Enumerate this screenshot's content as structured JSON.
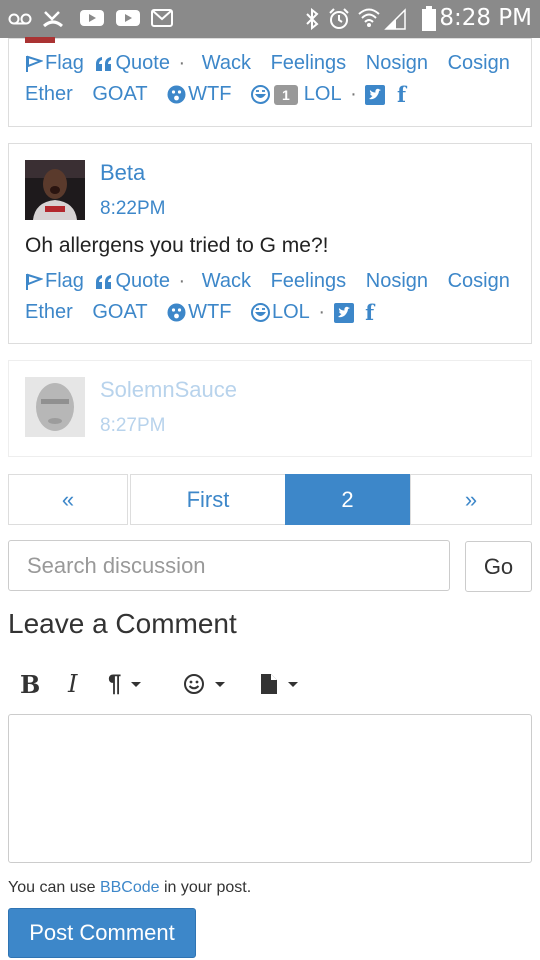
{
  "status_bar": {
    "time": "8:28 PM",
    "icons": [
      "voicemail-icon",
      "missed-call-icon",
      "youtube-icon",
      "youtube-icon",
      "gmail-icon",
      "bluetooth-icon",
      "alarm-icon",
      "wifi-icon",
      "signal-icon",
      "battery-icon"
    ]
  },
  "reactions": {
    "flag": "Flag",
    "quote": "Quote",
    "wack": "Wack",
    "feelings": "Feelings",
    "nosign": "Nosign",
    "cosign": "Cosign",
    "ether": "Ether",
    "goat": "GOAT",
    "wtf": "WTF",
    "lol": "LOL",
    "separator": "·",
    "facebook": "f"
  },
  "comments": [
    {
      "lol_count": "1"
    },
    {
      "author": "Beta",
      "time": "8:22PM",
      "body": "Oh allergens you tried to G me?!"
    },
    {
      "author": "SolemnSauce",
      "time": "8:27PM"
    }
  ],
  "pagination": {
    "prev": "«",
    "first": "First",
    "current": "2",
    "next": "»"
  },
  "search": {
    "placeholder": "Search discussion",
    "go_label": "Go"
  },
  "leave_comment": {
    "title": "Leave a Comment",
    "toolbar": {
      "bold": "B",
      "italic": "I",
      "paragraph": "¶"
    },
    "hint_before": "You can use",
    "hint_link": "BBCode",
    "hint_after": "in your post.",
    "post_label": "Post Comment"
  },
  "colors": {
    "accent": "#3d87c9",
    "status_bar": "#8a8a8a",
    "badge": "#999999"
  }
}
